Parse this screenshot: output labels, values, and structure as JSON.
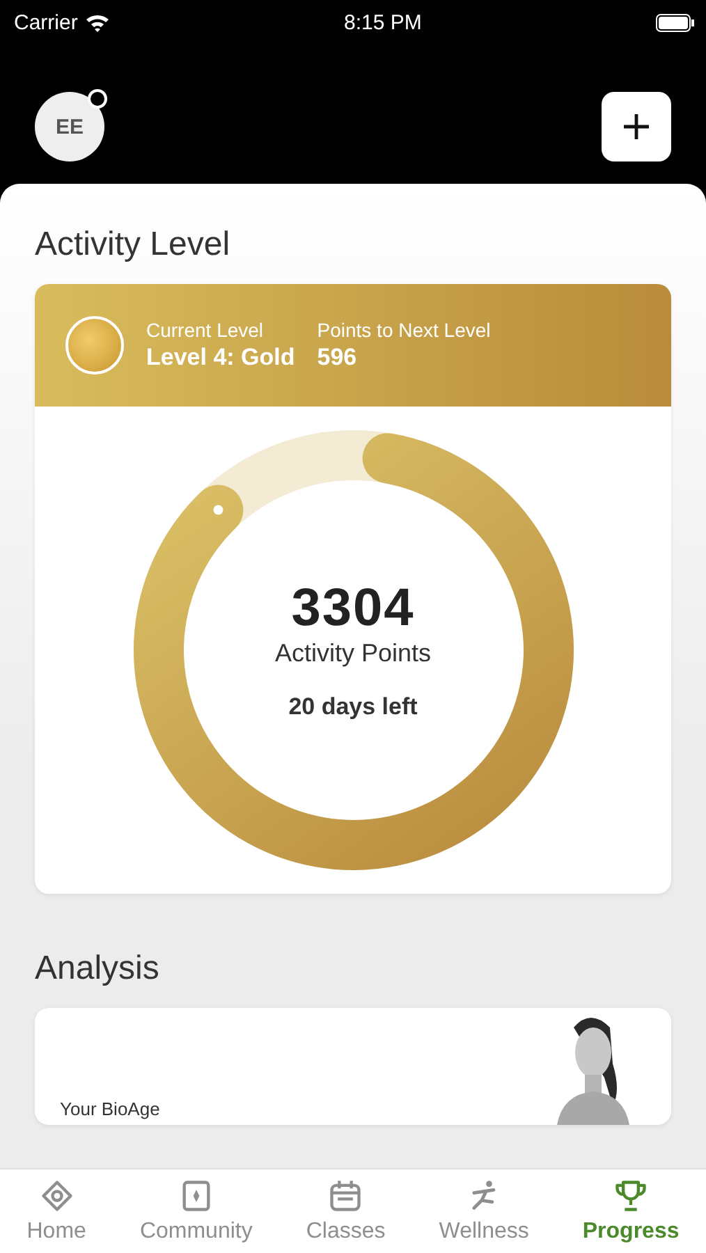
{
  "status_bar": {
    "carrier": "Carrier",
    "time": "8:15 PM"
  },
  "header": {
    "avatar_initials": "EE",
    "notification_dot": true
  },
  "activity": {
    "title": "Activity Level",
    "current_level_label": "Current Level",
    "current_level": "Level 4: Gold",
    "next_label": "Points to Next Level",
    "next_points": "596",
    "points": "3304",
    "points_label": "Activity Points",
    "days_left": "20 days left",
    "level": 0.85
  },
  "analysis": {
    "title": "Analysis",
    "card_text": "Your BioAge"
  },
  "tabs": [
    {
      "label": "Home",
      "selected": false
    },
    {
      "label": "Community",
      "selected": false
    },
    {
      "label": "Classes",
      "selected": false
    },
    {
      "label": "Wellness",
      "selected": false
    },
    {
      "label": "Progress",
      "selected": true
    }
  ]
}
